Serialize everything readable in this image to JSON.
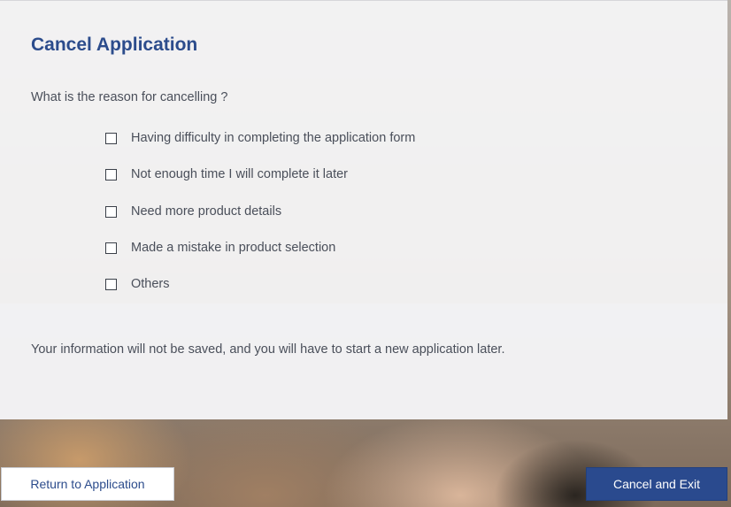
{
  "dialog": {
    "title": "Cancel Application",
    "question": "What is the reason for cancelling ?",
    "options": [
      {
        "label": "Having difficulty in completing the application form",
        "checked": false
      },
      {
        "label": "Not enough time I will complete it later",
        "checked": false
      },
      {
        "label": "Need more product details",
        "checked": false
      },
      {
        "label": "Made a mistake in product selection",
        "checked": false
      },
      {
        "label": "Others",
        "checked": false
      }
    ],
    "notice": "Your information will not be saved, and you will have to start a new application later."
  },
  "actions": {
    "return_label": "Return to Application",
    "exit_label": "Cancel and Exit"
  },
  "colors": {
    "title": "#2c4c8c",
    "primary_button": "#2a4a8e",
    "text": "#4a4f5a"
  }
}
